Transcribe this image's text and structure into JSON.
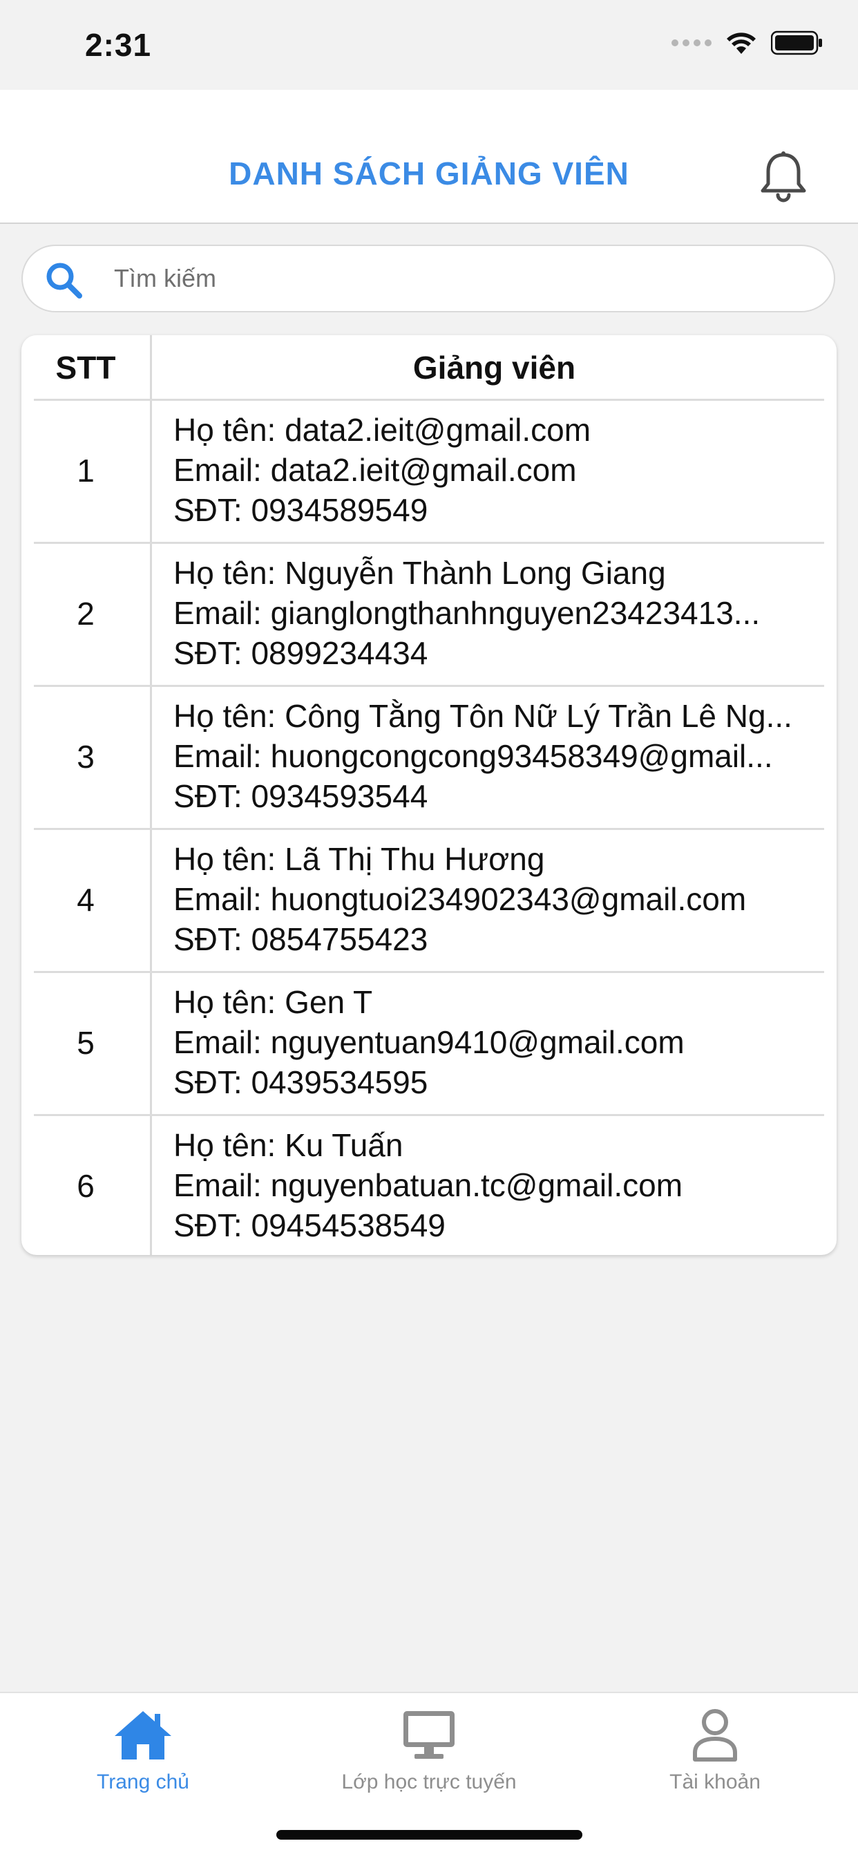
{
  "status_bar": {
    "time": "2:31"
  },
  "header": {
    "title": "DANH SÁCH GIẢNG VIÊN"
  },
  "search": {
    "placeholder": "Tìm kiếm"
  },
  "table": {
    "columns": [
      "STT",
      "Giảng viên"
    ],
    "rows": [
      {
        "stt": "1",
        "name": "Họ tên: data2.ieit@gmail.com",
        "email": "Email: data2.ieit@gmail.com",
        "phone": "SĐT: 0934589549"
      },
      {
        "stt": "2",
        "name": "Họ tên: Nguyễn Thành Long Giang",
        "email": "Email: gianglongthanhnguyen23423413...",
        "phone": "SĐT: 0899234434"
      },
      {
        "stt": "3",
        "name": "Họ tên: Công Tằng Tôn Nữ Lý Trần Lê Ng...",
        "email": "Email: huongcongcong93458349@gmail...",
        "phone": "SĐT: 0934593544"
      },
      {
        "stt": "4",
        "name": "Họ tên: Lã Thị Thu Hương",
        "email": "Email: huongtuoi234902343@gmail.com",
        "phone": "SĐT: 0854755423"
      },
      {
        "stt": "5",
        "name": "Họ tên: Gen T",
        "email": "Email: nguyentuan9410@gmail.com",
        "phone": "SĐT: 0439534595"
      },
      {
        "stt": "6",
        "name": "Họ tên: Ku Tuấn",
        "email": "Email: nguyenbatuan.tc@gmail.com",
        "phone": "SĐT: 09454538549"
      }
    ]
  },
  "tabbar": {
    "items": [
      {
        "label": "Trang chủ",
        "icon": "home-icon",
        "active": true
      },
      {
        "label": "Lớp học trực tuyến",
        "icon": "monitor-icon",
        "active": false
      },
      {
        "label": "Tài khoản",
        "icon": "user-icon",
        "active": false
      }
    ]
  },
  "colors": {
    "accent": "#3b8be5",
    "inactive": "#8e8e8e",
    "background": "#f2f2f2"
  }
}
